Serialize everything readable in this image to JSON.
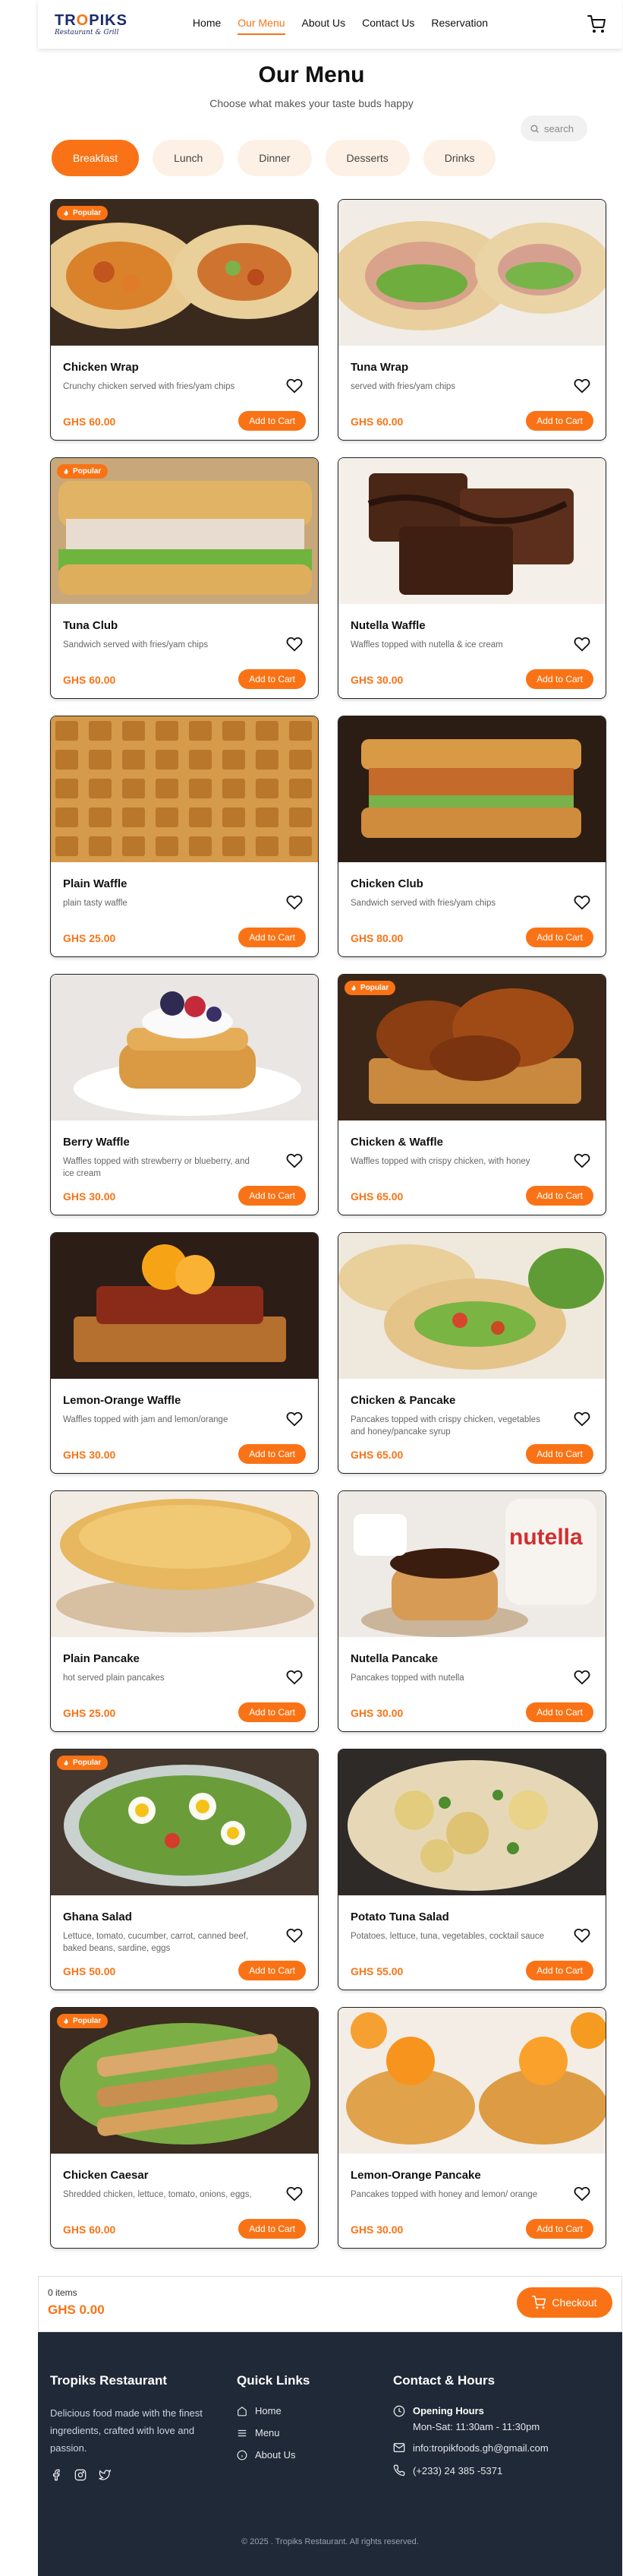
{
  "header": {
    "logo_brand_pre": "TR",
    "logo_brand_o": "O",
    "logo_brand_post": "PIKS",
    "logo_sub": "Restaurant & Grill",
    "nav": [
      {
        "label": "Home"
      },
      {
        "label": "Our Menu",
        "active": true
      },
      {
        "label": "About Us"
      },
      {
        "label": "Contact Us"
      },
      {
        "label": "Reservation"
      }
    ]
  },
  "hero": {
    "title": "Our Menu",
    "subtitle": "Choose what makes your taste buds happy",
    "search_placeholder": "search"
  },
  "tabs": [
    {
      "label": "Breakfast",
      "active": true
    },
    {
      "label": "Lunch"
    },
    {
      "label": "Dinner"
    },
    {
      "label": "Desserts"
    },
    {
      "label": "Drinks"
    }
  ],
  "badge_label": "Popular",
  "add_label": "Add to Cart",
  "items": [
    {
      "name": "Chicken Wrap",
      "desc": "Crunchy chicken served with fries/yam chips",
      "price": "GHS  60.00",
      "popular": true,
      "img": "wrap"
    },
    {
      "name": "Tuna Wrap",
      "desc": "served with fries/yam chips",
      "price": "GHS  60.00",
      "popular": false,
      "img": "wrap2"
    },
    {
      "name": "Tuna Club",
      "desc": "Sandwich served with fries/yam chips",
      "price": "GHS  60.00",
      "popular": true,
      "img": "sandwich"
    },
    {
      "name": "Nutella Waffle",
      "desc": "Waffles topped with nutella & ice cream",
      "price": "GHS  30.00",
      "popular": false,
      "img": "choc"
    },
    {
      "name": "Plain Waffle",
      "desc": "plain tasty waffle",
      "price": "GHS  25.00",
      "popular": false,
      "img": "waffle"
    },
    {
      "name": "Chicken Club",
      "desc": "Sandwich served with fries/yam chips",
      "price": "GHS  80.00",
      "popular": false,
      "img": "club"
    },
    {
      "name": "Berry Waffle",
      "desc": "Waffles topped with strewberry or blueberry, and ice cream",
      "price": "GHS  30.00",
      "popular": false,
      "img": "berry"
    },
    {
      "name": "Chicken & Waffle",
      "desc": "Waffles topped with crispy chicken, with honey",
      "price": "GHS  65.00",
      "popular": true,
      "img": "chickwaffle"
    },
    {
      "name": "Lemon-Orange Waffle",
      "desc": "Waffles topped with jam and lemon/orange",
      "price": "GHS  30.00",
      "popular": false,
      "img": "orangewaffle"
    },
    {
      "name": "Chicken & Pancake",
      "desc": "Pancakes topped with crispy chicken, vegetables and honey/pancake syrup",
      "price": "GHS  65.00",
      "popular": false,
      "img": "taco"
    },
    {
      "name": "Plain Pancake",
      "desc": "hot served plain pancakes",
      "price": "GHS  25.00",
      "popular": false,
      "img": "pancake"
    },
    {
      "name": "Nutella Pancake",
      "desc": "Pancakes topped with nutella",
      "price": "GHS  30.00",
      "popular": false,
      "img": "nutella"
    },
    {
      "name": "Ghana Salad",
      "desc": "Lettuce, tomato, cucumber, carrot, canned beef, baked beans, sardine, eggs",
      "price": "GHS  50.00",
      "popular": true,
      "img": "salad"
    },
    {
      "name": "Potato Tuna Salad",
      "desc": "Potatoes, lettuce, tuna, vegetables, cocktail sauce",
      "price": "GHS  55.00",
      "popular": false,
      "img": "potato"
    },
    {
      "name": "Chicken Caesar",
      "desc": "Shredded chicken, lettuce, tomato, onions, eggs,",
      "price": "GHS  60.00",
      "popular": true,
      "img": "caesar"
    },
    {
      "name": "Lemon-Orange Pancake",
      "desc": "Pancakes topped with honey and lemon/ orange",
      "price": "GHS  30.00",
      "popular": false,
      "img": "orangepancake"
    }
  ],
  "nutella_label": "nutella",
  "cart": {
    "items": "0 items",
    "total": "GHS  0.00",
    "checkout": "Checkout"
  },
  "footer": {
    "title": "Tropiks Restaurant",
    "about": "Delicious food made with the finest ingredients, crafted with love and passion.",
    "links_title": "Quick Links",
    "links": [
      "Home",
      "Menu",
      "About Us"
    ],
    "contact_title": "Contact & Hours",
    "hours_label": "Opening Hours",
    "hours": "Mon-Sat: 11:30am - 11:30pm",
    "email": "info:tropikfoods.gh@gmail.com",
    "phone": "(+233) 24 385 -5371",
    "copyright": "© 2025 . Tropiks Restaurant. All rights reserved."
  },
  "colors": {
    "accent": "#f97316",
    "footer_bg": "#1f2937",
    "tab_bg": "#fdf1e6"
  },
  "icons": [
    "cart-icon",
    "search-icon",
    "heart-icon",
    "fire-icon",
    "facebook-icon",
    "instagram-icon",
    "twitter-icon",
    "home-icon",
    "menu-icon",
    "info-icon",
    "clock-icon",
    "mail-icon",
    "phone-icon"
  ]
}
